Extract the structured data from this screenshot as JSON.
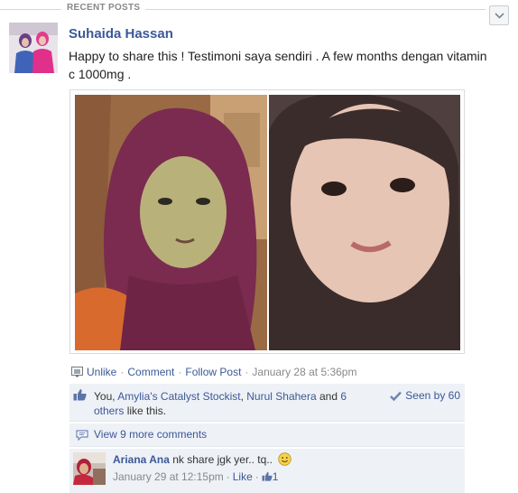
{
  "section": {
    "title": "RECENT POSTS"
  },
  "post": {
    "author": "Suhaida Hassan",
    "message": "Happy to share this ! Testimoni saya sendiri . A few months dengan vitamin c 1000mg .",
    "actions": {
      "unlike": "Unlike",
      "comment": "Comment",
      "follow": "Follow Post",
      "timestamp": "January 28 at 5:36pm"
    },
    "likes": {
      "you": "You,",
      "person1": "Amylia's Catalyst Stockist",
      "person2": "Nurul Shahera",
      "and": "and",
      "others": "6 others",
      "suffix": "like this."
    },
    "seen_by": "Seen by 60",
    "view_more": "View 9 more comments",
    "comment": {
      "author": "Ariana Ana",
      "text": "nk share jgk yer.. tq..",
      "timestamp": "January 29 at 12:15pm",
      "like": "Like",
      "like_count": "1"
    }
  },
  "icons": {
    "collapse": "chevron-down-icon",
    "privacy": "friends-icon",
    "like": "thumbs-up-icon",
    "seen": "checkmark-icon",
    "comments": "speech-bubble-icon",
    "smiley": "smiley-icon"
  },
  "colors": {
    "link": "#3b5998",
    "ufi_background": "#eef1f6",
    "muted": "#888888"
  }
}
